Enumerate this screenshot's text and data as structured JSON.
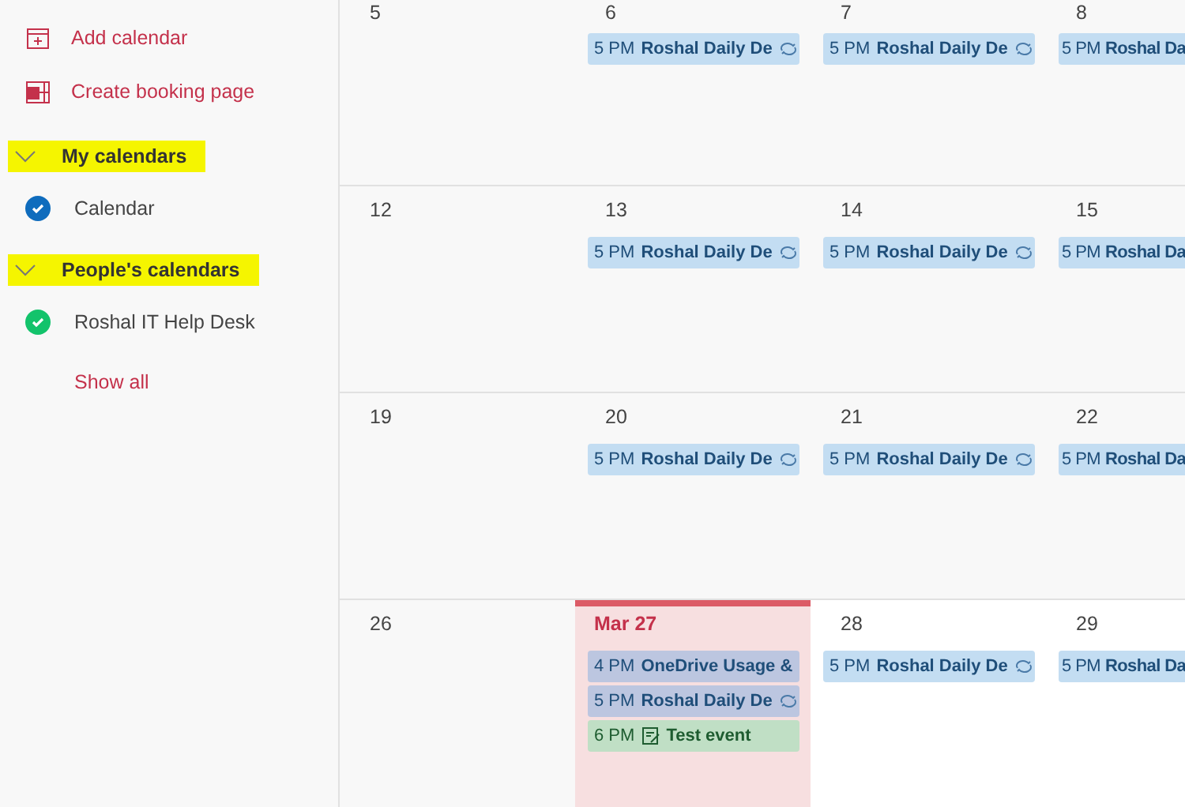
{
  "sidebar": {
    "actions": [
      {
        "kind": "add",
        "label": "Add calendar"
      },
      {
        "kind": "booking",
        "label": "Create booking page"
      }
    ],
    "groups": [
      {
        "title": "My calendars",
        "expanded": true,
        "highlighted": true,
        "calendars": [
          {
            "name": "Calendar",
            "checked": true,
            "color": "#0f6cbd"
          }
        ]
      },
      {
        "title": "People's calendars",
        "expanded": true,
        "highlighted": true,
        "calendars": [
          {
            "name": "Roshal IT Help Desk",
            "checked": true,
            "color": "#13c36b"
          }
        ]
      }
    ],
    "show_all": "Show all"
  },
  "weeks": [
    {
      "days": [
        {
          "label": "5",
          "kind": "past"
        },
        {
          "label": "6",
          "kind": "past",
          "events": [
            {
              "time": "5 PM",
              "title": "Roshal Daily De",
              "kind": "recurring",
              "color": "#c3ddf2"
            }
          ]
        },
        {
          "label": "7",
          "kind": "past",
          "events": [
            {
              "time": "5 PM",
              "title": "Roshal Daily De",
              "kind": "recurring",
              "color": "#c3ddf2"
            }
          ]
        },
        {
          "label": "8",
          "kind": "past",
          "events": [
            {
              "time": "5 PM",
              "title": "Roshal Da",
              "kind": "plain",
              "color": "#c3ddf2"
            }
          ]
        }
      ]
    },
    {
      "days": [
        {
          "label": "12",
          "kind": "past"
        },
        {
          "label": "13",
          "kind": "past",
          "events": [
            {
              "time": "5 PM",
              "title": "Roshal Daily De",
              "kind": "recurring",
              "color": "#c3ddf2"
            }
          ]
        },
        {
          "label": "14",
          "kind": "past",
          "events": [
            {
              "time": "5 PM",
              "title": "Roshal Daily De",
              "kind": "recurring",
              "color": "#c3ddf2"
            }
          ]
        },
        {
          "label": "15",
          "kind": "past",
          "events": [
            {
              "time": "5 PM",
              "title": "Roshal Da",
              "kind": "plain",
              "color": "#c3ddf2"
            }
          ]
        }
      ]
    },
    {
      "days": [
        {
          "label": "19",
          "kind": "past"
        },
        {
          "label": "20",
          "kind": "past",
          "events": [
            {
              "time": "5 PM",
              "title": "Roshal Daily De",
              "kind": "recurring",
              "color": "#c3ddf2"
            }
          ]
        },
        {
          "label": "21",
          "kind": "past",
          "events": [
            {
              "time": "5 PM",
              "title": "Roshal Daily De",
              "kind": "recurring",
              "color": "#c3ddf2"
            }
          ]
        },
        {
          "label": "22",
          "kind": "past",
          "events": [
            {
              "time": "5 PM",
              "title": "Roshal Da",
              "kind": "plain",
              "color": "#c3ddf2"
            }
          ]
        }
      ]
    },
    {
      "days": [
        {
          "label": "26",
          "kind": "past"
        },
        {
          "label": "Mar 27",
          "kind": "today",
          "events": [
            {
              "time": "4 PM",
              "title": "OneDrive Usage &",
              "kind": "plain",
              "color": "#bcc6e0"
            },
            {
              "time": "5 PM",
              "title": "Roshal Daily De",
              "kind": "recurring",
              "color": "#bcc6e0"
            },
            {
              "time": "6 PM",
              "title": "Test event",
              "kind": "note",
              "color": "#c0dfc5"
            }
          ]
        },
        {
          "label": "28",
          "kind": "future",
          "events": [
            {
              "time": "5 PM",
              "title": "Roshal Daily De",
              "kind": "recurring",
              "color": "#c3ddf2"
            }
          ]
        },
        {
          "label": "29",
          "kind": "future",
          "events": [
            {
              "time": "5 PM",
              "title": "Roshal Da",
              "kind": "plain",
              "color": "#c3ddf2"
            }
          ]
        }
      ]
    }
  ]
}
